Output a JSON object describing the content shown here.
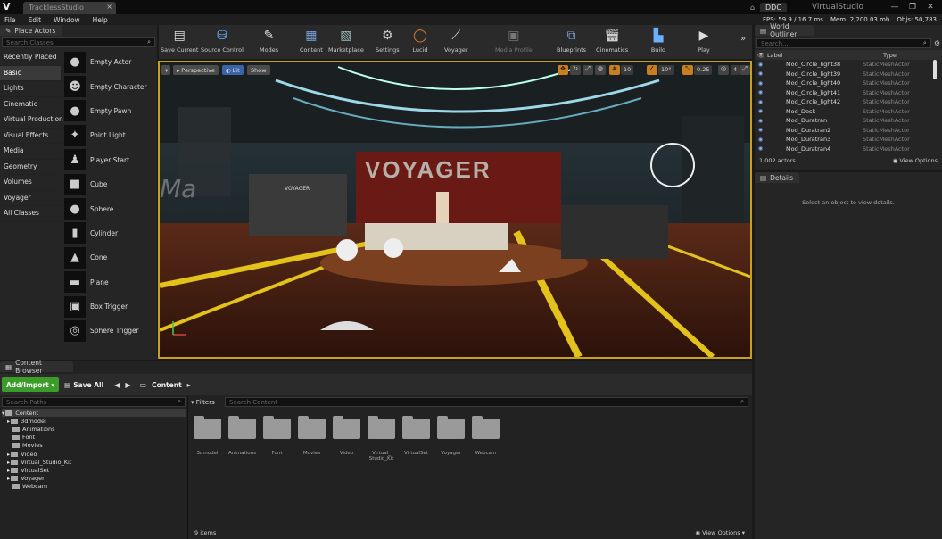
{
  "titlebar": {
    "tab": "TracklessStudio",
    "ddc": "DDC",
    "project": "VirtualStudio",
    "window_controls": [
      "—",
      "❐",
      "✕"
    ]
  },
  "menus": [
    "File",
    "Edit",
    "Window",
    "Help"
  ],
  "stats": {
    "fps": "FPS: 59.9",
    "ms": "/ 16.7 ms",
    "mem": "Mem: 2,200.03 mb",
    "objs": "Objs: 50,783"
  },
  "place_actors": {
    "tab": "Place Actors",
    "search_placeholder": "Search Classes",
    "categories": [
      "Recently Placed",
      "Basic",
      "Lights",
      "Cinematic",
      "Virtual Production",
      "Visual Effects",
      "Media",
      "Geometry",
      "Volumes",
      "Voyager",
      "All Classes"
    ],
    "selected": "Basic",
    "actors": [
      {
        "label": "Empty Actor",
        "icon": "sphere-icon"
      },
      {
        "label": "Empty Character",
        "icon": "character-icon"
      },
      {
        "label": "Empty Pawn",
        "icon": "pawn-icon"
      },
      {
        "label": "Point Light",
        "icon": "light-bulb-icon"
      },
      {
        "label": "Player Start",
        "icon": "player-start-icon"
      },
      {
        "label": "Cube",
        "icon": "cube-icon"
      },
      {
        "label": "Sphere",
        "icon": "sphere-icon"
      },
      {
        "label": "Cylinder",
        "icon": "cylinder-icon"
      },
      {
        "label": "Cone",
        "icon": "cone-icon"
      },
      {
        "label": "Plane",
        "icon": "plane-icon"
      },
      {
        "label": "Box Trigger",
        "icon": "box-trigger-icon"
      },
      {
        "label": "Sphere Trigger",
        "icon": "sphere-trigger-icon"
      }
    ]
  },
  "toolbar": [
    {
      "label": "Save Current",
      "icon": "save-icon"
    },
    {
      "label": "Source Control",
      "icon": "source-control-icon"
    },
    {
      "label": "Modes",
      "icon": "modes-icon"
    },
    {
      "label": "Content",
      "icon": "content-icon"
    },
    {
      "label": "Marketplace",
      "icon": "marketplace-icon"
    },
    {
      "label": "Settings",
      "icon": "settings-icon"
    },
    {
      "label": "Lucid",
      "icon": "lucid-icon"
    },
    {
      "label": "Voyager",
      "icon": "voyager-icon"
    },
    {
      "label": "Media Profile",
      "icon": "media-profile-icon"
    },
    {
      "label": "Blueprints",
      "icon": "blueprints-icon"
    },
    {
      "label": "Cinematics",
      "icon": "cinematics-icon"
    },
    {
      "label": "Build",
      "icon": "build-icon"
    },
    {
      "label": "Play",
      "icon": "play-icon"
    }
  ],
  "viewport": {
    "perspective": "Perspective",
    "lit": "Lit",
    "show": "Show",
    "snap_grid": "10",
    "snap_angle": "10°",
    "snap_scale": "0.25",
    "camera_speed": "4",
    "sign_text": "VOYAGER",
    "small_logo": "VOYAGER",
    "wall_text": "Ma"
  },
  "world_outliner": {
    "tab": "World Outliner",
    "search_placeholder": "Search...",
    "col_label": "Label",
    "col_type": "Type",
    "rows": [
      {
        "label": "Mod_Circle_light38",
        "type": "StaticMeshActor"
      },
      {
        "label": "Mod_Circle_light39",
        "type": "StaticMeshActor"
      },
      {
        "label": "Mod_Circle_light40",
        "type": "StaticMeshActor"
      },
      {
        "label": "Mod_Circle_light41",
        "type": "StaticMeshActor"
      },
      {
        "label": "Mod_Circle_light42",
        "type": "StaticMeshActor"
      },
      {
        "label": "Mod_Desk",
        "type": "StaticMeshActor"
      },
      {
        "label": "Mod_Duratran",
        "type": "StaticMeshActor"
      },
      {
        "label": "Mod_Duratran2",
        "type": "StaticMeshActor"
      },
      {
        "label": "Mod_Duratran3",
        "type": "StaticMeshActor"
      },
      {
        "label": "Mod_Duratran4",
        "type": "StaticMeshActor"
      }
    ],
    "count": "1,002 actors",
    "view_options": "View Options"
  },
  "details": {
    "tab": "Details",
    "empty": "Select an object to view details."
  },
  "content_browser": {
    "tab": "Content Browser",
    "add_import": "Add/Import",
    "save_all": "Save All",
    "path": "Content",
    "search_paths": "Search Paths",
    "filters": "Filters",
    "search_content": "Search Content",
    "tree_root": "Content",
    "tree": [
      "3dmodel",
      "Animations",
      "Font",
      "Movies",
      "Video",
      "Virtual_Studio_Kit",
      "VirtualSet",
      "Voyager",
      "Webcam"
    ],
    "folders": [
      "3dmodel",
      "Animations",
      "Font",
      "Movies",
      "Video",
      "Virtual_ Studio_Kit",
      "VirtualSet",
      "Voyager",
      "Webcam"
    ],
    "item_count": "9 items",
    "view_options": "View Options"
  },
  "colors": {
    "viewport_border": "#c8a020",
    "add_button": "#3c9c2a",
    "selection": "#3a3a3a"
  }
}
